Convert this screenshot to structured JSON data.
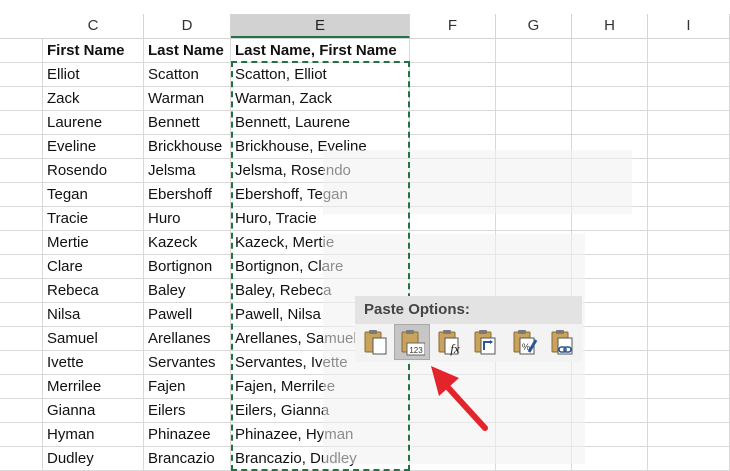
{
  "columns": [
    "C",
    "D",
    "E",
    "F",
    "G",
    "H",
    "I"
  ],
  "selected_column": "E",
  "headers": [
    "First Name",
    "Last Name",
    "Last Name, First Name"
  ],
  "rows": [
    [
      "Elliot",
      "Scatton",
      "Scatton, Elliot"
    ],
    [
      "Zack",
      "Warman",
      "Warman, Zack"
    ],
    [
      "Laurene",
      "Bennett",
      "Bennett, Laurene"
    ],
    [
      "Eveline",
      "Brickhouse",
      "Brickhouse, Eveline"
    ],
    [
      "Rosendo",
      "Jelsma",
      "Jelsma, Rosendo"
    ],
    [
      "Tegan",
      "Ebershoff",
      "Ebershoff, Tegan"
    ],
    [
      "Tracie",
      "Huro",
      "Huro, Tracie"
    ],
    [
      "Mertie",
      "Kazeck",
      "Kazeck, Mertie"
    ],
    [
      "Clare",
      "Bortignon",
      "Bortignon, Clare"
    ],
    [
      "Rebeca",
      "Baley",
      "Baley, Rebeca"
    ],
    [
      "Nilsa",
      "Pawell",
      "Pawell, Nilsa"
    ],
    [
      "Samuel",
      "Arellanes",
      "Arellanes, Samuel"
    ],
    [
      "Ivette",
      "Servantes",
      "Servantes, Ivette"
    ],
    [
      "Merrilee",
      "Fajen",
      "Fajen, Merrilee"
    ],
    [
      "Gianna",
      "Eilers",
      "Eilers, Gianna"
    ],
    [
      "Hyman",
      "Phinazee",
      "Phinazee, Hyman"
    ],
    [
      "Dudley",
      "Brancazio",
      "Brancazio, Dudley"
    ]
  ],
  "paste_options": {
    "title": "Paste Options:",
    "buttons": [
      {
        "icon": "paste-icon",
        "active": false
      },
      {
        "icon": "paste-values-icon",
        "label": "123",
        "active": true
      },
      {
        "icon": "paste-formulas-icon",
        "active": false
      },
      {
        "icon": "paste-transpose-icon",
        "active": false
      },
      {
        "icon": "paste-formatting-icon",
        "active": false
      },
      {
        "icon": "paste-link-icon",
        "active": false
      }
    ]
  },
  "colors": {
    "selection": "#217346",
    "arrow": "#e3242b"
  }
}
